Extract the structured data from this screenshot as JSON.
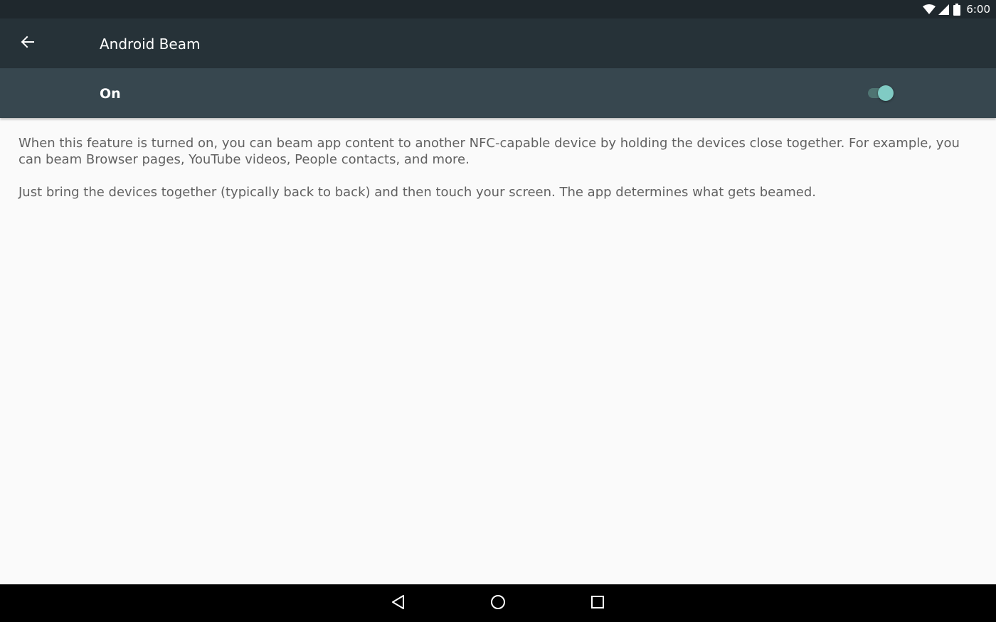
{
  "status_bar": {
    "time": "6:00",
    "icons": [
      "wifi-icon",
      "cellular-signal-icon",
      "battery-icon"
    ]
  },
  "app_bar": {
    "title": "Android Beam",
    "back_icon": "arrow-back-icon"
  },
  "master_switch": {
    "label": "On",
    "checked": true
  },
  "content": {
    "paragraphs": [
      "When this feature is turned on, you can beam app content to another NFC-capable device by holding the devices close together. For example, you can beam Browser pages, YouTube videos, People contacts, and more.",
      "Just bring the devices together (typically back to back) and then touch your screen. The app determines what gets beamed."
    ]
  },
  "nav_bar": {
    "buttons": [
      "nav-back-icon",
      "nav-home-icon",
      "nav-recents-icon"
    ]
  },
  "colors": {
    "status_bar": "#1f282d",
    "app_bar": "#263238",
    "switch_bar": "#37474f",
    "accent": "#80cbc4",
    "background": "#fafafa",
    "body_text": "#616161"
  }
}
